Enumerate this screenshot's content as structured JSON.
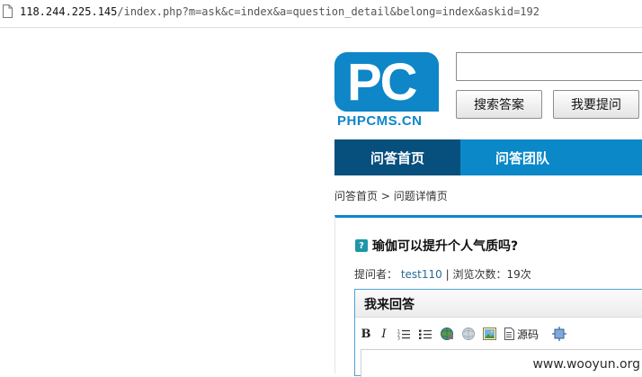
{
  "address_bar": {
    "host": "118.244.225.145",
    "path": "/index.php?m=ask&c=index&a=question_detail&belong=index&askid=192"
  },
  "header": {
    "logo_letters": "PC",
    "logo_text": "PHPCMS.CN",
    "search_value": "",
    "search_button_label": "搜索答案",
    "ask_button_label": "我要提问"
  },
  "nav": {
    "tabs": [
      {
        "label": "问答首页",
        "active": true
      },
      {
        "label": "问答团队",
        "active": false
      }
    ]
  },
  "breadcrumb": {
    "home": "问答首页",
    "separator": ">",
    "current": "问题详情页"
  },
  "question": {
    "icon": "question-icon",
    "title": "瑜伽可以提升个人气质吗?",
    "asker_label": "提问者：",
    "asker": "test110",
    "divider": "|",
    "views_label": "浏览次数：",
    "views": "19次"
  },
  "answer": {
    "title": "我来回答",
    "toolbar": {
      "bold": "B",
      "italic": "I",
      "source_label": "源码"
    }
  },
  "watermark": "www.wooyun.org",
  "colors": {
    "brand_blue": "#0e86c8",
    "nav_active": "#074f7d"
  }
}
